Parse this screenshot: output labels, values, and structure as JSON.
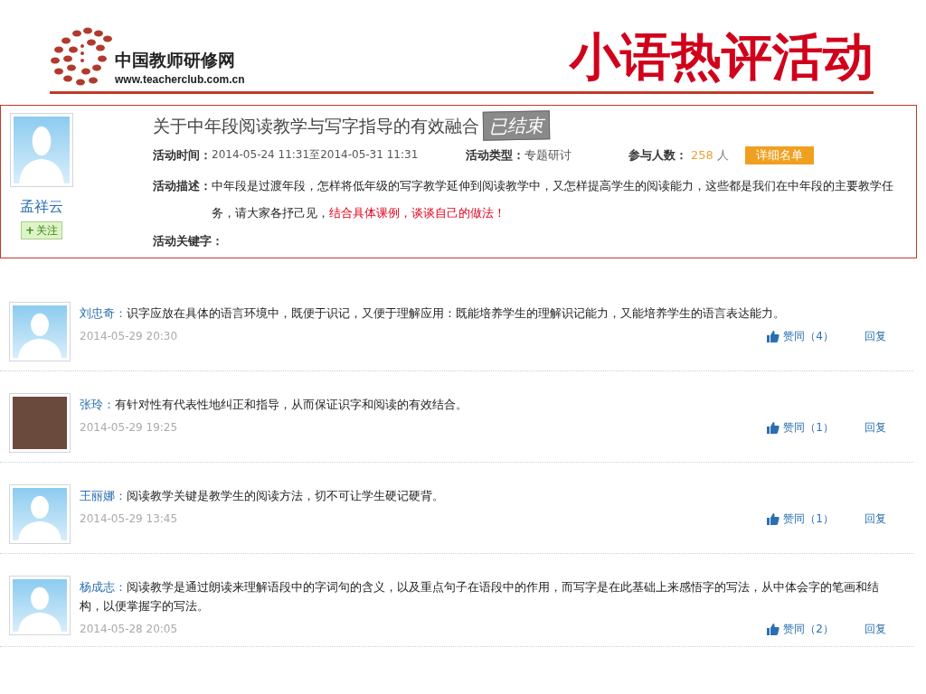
{
  "header": {
    "logo_name": "中国教师研修网",
    "logo_url": "www.teacherclub.com.cn",
    "slide_title": "小语热评活动"
  },
  "activity": {
    "author": "孟祥云",
    "follow_icon": "+",
    "follow_label": "关注",
    "title": "关于中年段阅读教学与写字指导的有效融合",
    "status_stamp": "已结束",
    "time_label": "活动时间：",
    "time_value": "2014-05-24 11:31至2014-05-31 11:31",
    "type_label": "活动类型：",
    "type_value": "专题研讨",
    "count_label": "参与人数：",
    "count_value": "258",
    "count_unit": "人",
    "details_button": "详细名单",
    "description_label": "活动描述：",
    "description_text": "中年段是过渡年段，怎样将低年级的写字教学延伸到阅读教学中，又怎样提高学生的阅读能力，这些都是我们在中年段的主要教学任务，请大家各抒己见，",
    "description_highlight": "结合具体课例，谈谈自己的做法！",
    "keywords_label": "活动关键字："
  },
  "comments": [
    {
      "kind": "default",
      "author": "刘忠奇：",
      "text": "识字应放在具体的语言环境中，既便于识记，又便于理解应用：既能培养学生的理解识记能力，又能培养学生的语言表达能力。",
      "time": "2014-05-29 20:30",
      "like": "赞同（4）",
      "reply": "回复"
    },
    {
      "kind": "photo",
      "author": "张玲：",
      "text": "有针对性有代表性地纠正和指导，从而保证识字和阅读的有效结合。",
      "time": "2014-05-29 19:25",
      "like": "赞同（1）",
      "reply": "回复"
    },
    {
      "kind": "default",
      "author": "王丽娜：",
      "text": "阅读教学关键是教学生的阅读方法，切不可让学生硬记硬背。",
      "time": "2014-05-29 13:45",
      "like": "赞同（1）",
      "reply": "回复"
    },
    {
      "kind": "default",
      "author": "杨成志：",
      "text": "阅读教学是通过朗读来理解语段中的字词句的含义，以及重点句子在语段中的作用，而写字是在此基础上来感悟字的写法，从中体会字的笔画和结构，以便掌握字的写法。",
      "time": "2014-05-28 20:05",
      "like": "赞同（2）",
      "reply": "回复"
    }
  ]
}
